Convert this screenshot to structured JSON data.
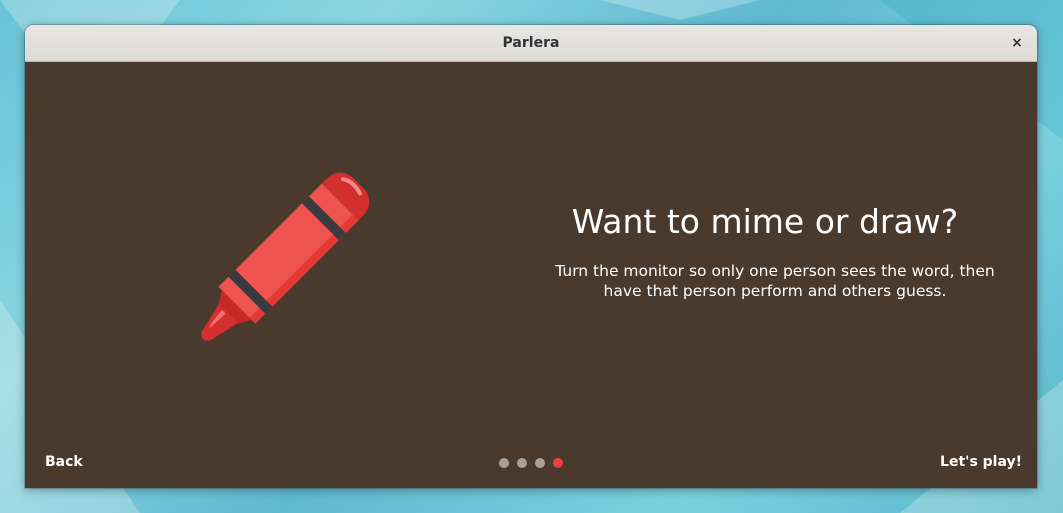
{
  "window": {
    "title": "Parlera",
    "close_icon": "×"
  },
  "slide": {
    "illustration": "crayon-icon",
    "heading": "Want to mime or draw?",
    "description": "Turn the monitor so only one person sees the word, then have that person perform and others guess."
  },
  "nav": {
    "back_label": "Back",
    "play_label": "Let's play!",
    "pages_total": 4,
    "page_active": 4
  },
  "colors": {
    "content_bg": "#4a3a2e",
    "accent": "#e8443f",
    "crayon_body": "#ef5350",
    "crayon_dark": "#c62828",
    "crayon_band": "#3b3b3f"
  }
}
